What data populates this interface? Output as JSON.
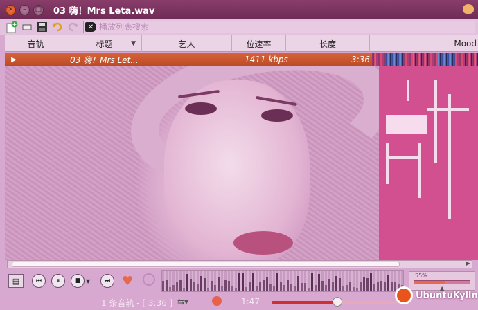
{
  "window": {
    "title": "03 嗨！Mrs Leta.wav",
    "close_glyph": "×",
    "min_glyph": "–",
    "max_glyph": "□"
  },
  "toolbar": {
    "icons": [
      "add-playlist-icon",
      "clear-icon",
      "save-icon",
      "undo-icon",
      "redo-icon"
    ],
    "search_placeholder": "播放列表搜索",
    "search_clear_glyph": "✕"
  },
  "columns": {
    "track": "音轨",
    "title": "标题",
    "artist": "艺人",
    "bitrate": "位速率",
    "length": "长度",
    "mood": "Mood"
  },
  "playlist": {
    "rows": [
      {
        "indicator": "▶",
        "title": "03 嗨！Mrs Let...",
        "bitrate": "1411 kbps",
        "length": "3:36"
      }
    ]
  },
  "status": {
    "summary": "1 条音轨 - [ 3:36 ]",
    "elapsed": "1:47",
    "volume_label": "55%",
    "volume": 0.55,
    "position": 0.5
  },
  "brand": {
    "text": "UbuntuKylin"
  },
  "colors": {
    "accent": "#d8643a",
    "window": "#6e2b55",
    "background": "#d7a8d0"
  }
}
